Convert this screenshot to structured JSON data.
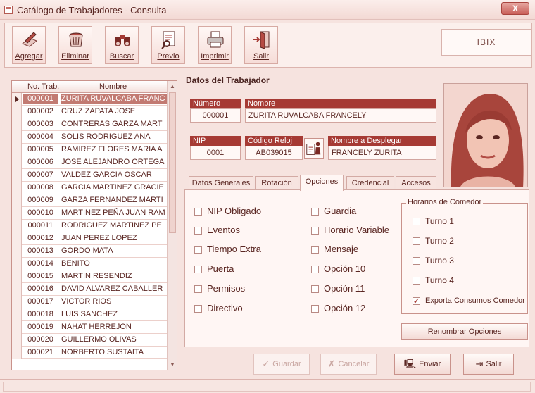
{
  "window": {
    "title": "Catálogo de Trabajadores - Consulta",
    "close_label": "X"
  },
  "toolbar": {
    "buttons": [
      {
        "label": "Agregar",
        "icon": "pen-paper-icon"
      },
      {
        "label": "Eliminar",
        "icon": "trash-icon"
      },
      {
        "label": "Buscar",
        "icon": "binoculars-icon"
      },
      {
        "label": "Previo",
        "icon": "print-preview-icon"
      },
      {
        "label": "Imprimir",
        "icon": "printer-icon"
      },
      {
        "label": "Salir",
        "icon": "exit-door-icon"
      }
    ],
    "brand": "IBIX"
  },
  "grid": {
    "columns": [
      "No. Trab.",
      "Nombre"
    ],
    "rows": [
      [
        "000001",
        "ZURITA RUVALCABA FRANC"
      ],
      [
        "000002",
        "CRUZ ZAPATA JOSE"
      ],
      [
        "000003",
        "CONTRERAS GARZA MART"
      ],
      [
        "000004",
        "SOLIS RODRIGUEZ ANA"
      ],
      [
        "000005",
        "RAMIREZ FLORES MARIA A"
      ],
      [
        "000006",
        "JOSE ALEJANDRO ORTEGA"
      ],
      [
        "000007",
        "VALDEZ GARCIA OSCAR"
      ],
      [
        "000008",
        "GARCIA MARTINEZ GRACIE"
      ],
      [
        "000009",
        "GARZA FERNANDEZ MARTI"
      ],
      [
        "000010",
        "MARTINEZ PEÑA JUAN RAM"
      ],
      [
        "000011",
        "RODRIGUEZ MARTINEZ PE"
      ],
      [
        "000012",
        "JUAN PEREZ LOPEZ"
      ],
      [
        "000013",
        "GORDO MATA"
      ],
      [
        "000014",
        "BENITO"
      ],
      [
        "000015",
        "MARTIN RESENDIZ"
      ],
      [
        "000016",
        "DAVID ALVAREZ CABALLER"
      ],
      [
        "000017",
        "VICTOR RIOS"
      ],
      [
        "000018",
        "LUIS SANCHEZ"
      ],
      [
        "000019",
        "NAHAT HERREJON"
      ],
      [
        "000020",
        "GUILLERMO OLIVAS"
      ],
      [
        "000021",
        "NORBERTO SUSTAITA"
      ]
    ],
    "selected_index": 0
  },
  "detail": {
    "title": "Datos del Trabajador",
    "numero_label": "Número",
    "numero_value": "000001",
    "nombre_label": "Nombre",
    "nombre_value": "ZURITA RUVALCABA FRANCELY",
    "nip_label": "NIP",
    "nip_value": "0001",
    "reloj_label": "Código Reloj",
    "reloj_value": "AB039015",
    "desplegar_label": "Nombre a Desplegar",
    "desplegar_value": "FRANCELY ZURITA"
  },
  "tabs": [
    "Datos Generales",
    "Rotación",
    "Opciones",
    "Credencial",
    "Accesos"
  ],
  "active_tab": "Opciones",
  "options": {
    "col1": [
      "NIP Obligado",
      "Eventos",
      "Tiempo Extra",
      "Puerta",
      "Permisos",
      "Directivo"
    ],
    "col2": [
      "Guardia",
      "Horario Variable",
      "Mensaje",
      "Opción 10",
      "Opción 11",
      "Opción 12"
    ]
  },
  "comedor": {
    "title": "Horarios de Comedor",
    "turnos": [
      "Turno 1",
      "Turno 2",
      "Turno 3",
      "Turno 4"
    ],
    "exporta_label": "Exporta Consumos Comedor",
    "exporta_checked": true,
    "rename_button": "Renombrar Opciones"
  },
  "actions": {
    "guardar": "Guardar",
    "cancelar": "Cancelar",
    "enviar": "Enviar",
    "salir": "Salir"
  },
  "colors": {
    "accent": "#a63a34",
    "selection": "#c27a72",
    "background": "#f6e3df"
  }
}
